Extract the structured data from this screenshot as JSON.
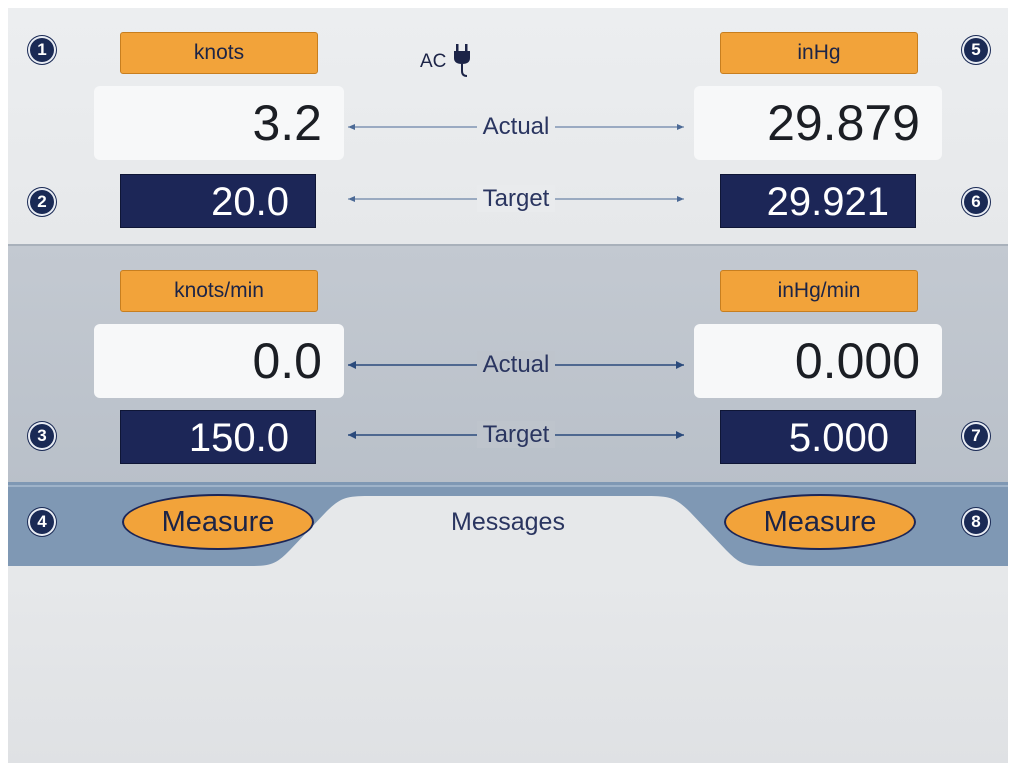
{
  "left": {
    "speed_unit": "knots",
    "speed_actual": "3.2",
    "speed_target": "20.0",
    "rate_unit": "knots/min",
    "rate_actual": "0.0",
    "rate_target": "150.0",
    "measure_label": "Measure"
  },
  "right": {
    "pressure_unit": "inHg",
    "pressure_actual": "29.879",
    "pressure_target": "29.921",
    "rate_unit": "inHg/min",
    "rate_actual": "0.000",
    "rate_target": "5.000",
    "measure_label": "Measure"
  },
  "labels": {
    "actual": "Actual",
    "target": "Target",
    "messages": "Messages",
    "ac": "AC"
  },
  "markers": [
    "1",
    "2",
    "3",
    "4",
    "5",
    "6",
    "7",
    "8"
  ],
  "icons": {
    "power": "ac-plug-icon"
  },
  "colors": {
    "unit_button": "#f2a33a",
    "target_box": "#1c2657",
    "marker": "#1a2a55",
    "messages_band": "#7f98b4"
  }
}
